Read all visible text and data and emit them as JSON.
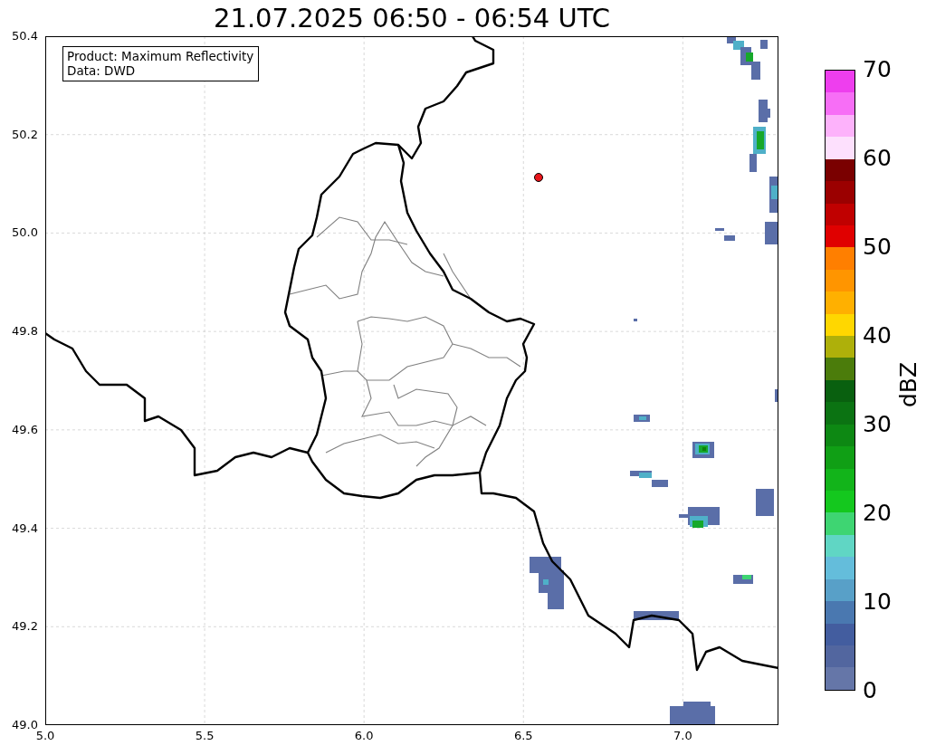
{
  "title": "21.07.2025 06:50 - 06:54 UTC",
  "legend": {
    "lines": [
      "Product: Maximum Reflectivity",
      "Data: DWD"
    ]
  },
  "map": {
    "x_ticks": [
      "5.0",
      "5.5",
      "6.0",
      "6.5",
      "7.0"
    ],
    "y_ticks": [
      "50.4",
      "50.2",
      "50.0",
      "49.8",
      "49.6",
      "49.4",
      "49.2",
      "49.0"
    ]
  },
  "colorbar": {
    "label": "dBZ",
    "ticks": [
      "70",
      "60",
      "50",
      "40",
      "30",
      "20",
      "10",
      "0"
    ],
    "segments": [
      {
        "color": "#ee3eee"
      },
      {
        "color": "#f76ef6"
      },
      {
        "color": "#fdb2fb"
      },
      {
        "color": "#fde0fd"
      },
      {
        "color": "#7a0000"
      },
      {
        "color": "#9b0000"
      },
      {
        "color": "#c00000"
      },
      {
        "color": "#e00000"
      },
      {
        "color": "#ff7f00"
      },
      {
        "color": "#ff9500"
      },
      {
        "color": "#ffb000"
      },
      {
        "color": "#ffd700"
      },
      {
        "color": "#aeb00a"
      },
      {
        "color": "#4b7c0b"
      },
      {
        "color": "#09600f"
      },
      {
        "color": "#0b7312"
      },
      {
        "color": "#0d8813"
      },
      {
        "color": "#109f15"
      },
      {
        "color": "#12b41a"
      },
      {
        "color": "#14c81e"
      },
      {
        "color": "#3ed572"
      },
      {
        "color": "#60d6c4"
      },
      {
        "color": "#64bddb"
      },
      {
        "color": "#58a0c8"
      },
      {
        "color": "#4a78b0"
      },
      {
        "color": "#435d9f"
      },
      {
        "color": "#52669f"
      },
      {
        "color": "#6576a8"
      }
    ]
  }
}
